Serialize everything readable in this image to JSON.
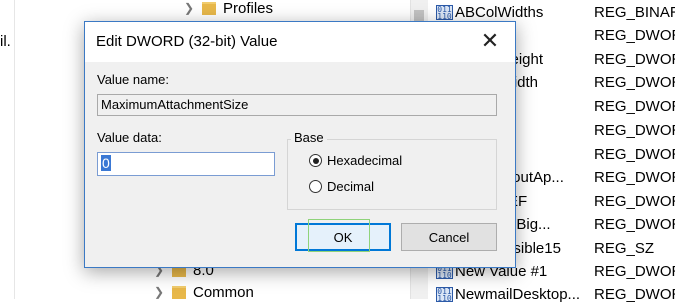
{
  "background": {
    "left_edge_text": "il.",
    "tree_items": [
      {
        "label": "Profiles"
      },
      {
        "label": "8.0"
      },
      {
        "label": "Common"
      }
    ],
    "values": [
      {
        "name": "ABColWidths",
        "type": "REG_BINARY"
      },
      {
        "name": "ight",
        "type": "REG_DWORD"
      },
      {
        "name": "alHeight",
        "type": "REG_DWORD"
      },
      {
        "name": "alWidth",
        "type": "REG_DWORD"
      },
      {
        "name": "",
        "type": "REG_DWORD"
      },
      {
        "name": "",
        "type": "REG_DWORD"
      },
      {
        "name": "h",
        "type": "REG_DWORD"
      },
      {
        "name": "LayoutAp...",
        "type": "REG_DWORD"
      },
      {
        "name": "TNEF",
        "type": "REG_DWORD"
      },
      {
        "name": "odernBig...",
        "type": "REG_DWORD"
      },
      {
        "name": "eVisible15",
        "type": "REG_SZ"
      },
      {
        "name": "New Value #1",
        "type": "REG_DWORD"
      },
      {
        "name": "NewmailDesktop...",
        "type": "REG_DWORD"
      }
    ]
  },
  "dialog": {
    "title": "Edit DWORD (32-bit) Value",
    "close_glyph": "✕",
    "value_name_label": "Value name:",
    "value_name": "MaximumAttachmentSize",
    "value_data_label": "Value data:",
    "value_data": "0",
    "base_label": "Base",
    "radio_hex_label": "Hexadecimal",
    "radio_dec_label": "Decimal",
    "selected_base": "Hexadecimal",
    "ok_label": "OK",
    "cancel_label": "Cancel"
  },
  "colors": {
    "accent": "#0078d7",
    "dialog_bg": "#f0f0f0",
    "folder": "#e8b84a"
  },
  "icons": {
    "folder": "folder-icon",
    "registry_value": "registry-value-icon",
    "close": "close-icon",
    "chevron": "chevron-right-icon"
  }
}
